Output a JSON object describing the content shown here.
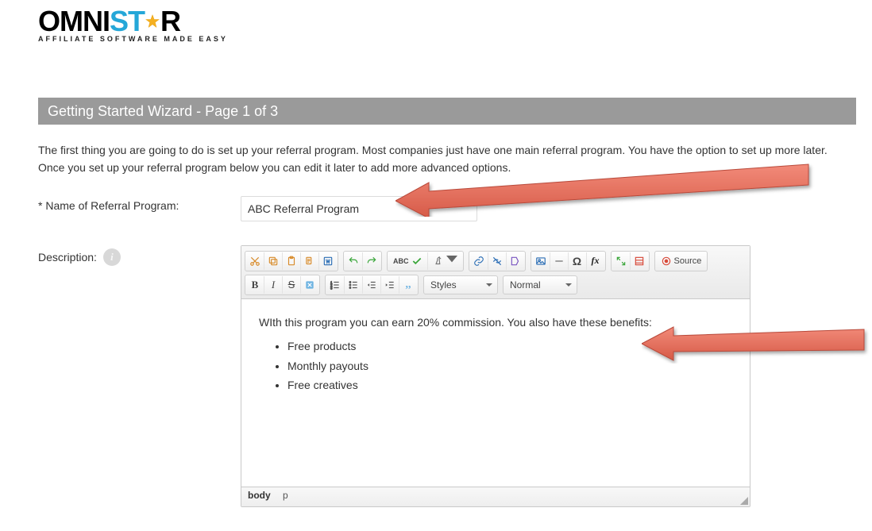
{
  "logo": {
    "part_omni": "OMNI",
    "part_st": "ST",
    "part_a": "A",
    "part_r": "R",
    "tagline": "AFFILIATE SOFTWARE MADE EASY"
  },
  "header": {
    "title": "Getting Started Wizard - Page 1 of 3"
  },
  "intro": "The first thing you are going to do is set up your referral program. Most companies just have one main referral program. You have the option to set up more later. Once you set up your referral program below you can edit it later to add more advanced options.",
  "fields": {
    "name_label": "* Name of Referral Program:",
    "name_value": "ABC Referral Program",
    "description_label": "Description:"
  },
  "info_glyph": "i",
  "editor": {
    "styles_label": "Styles",
    "format_label": "Normal",
    "source_label": "Source",
    "content_intro": "WIth this program you can earn 20% commission. You also have these benefits:",
    "bullets": [
      "Free products",
      "Monthly payouts",
      "Free creatives"
    ],
    "path_body": "body",
    "path_p": "p"
  }
}
